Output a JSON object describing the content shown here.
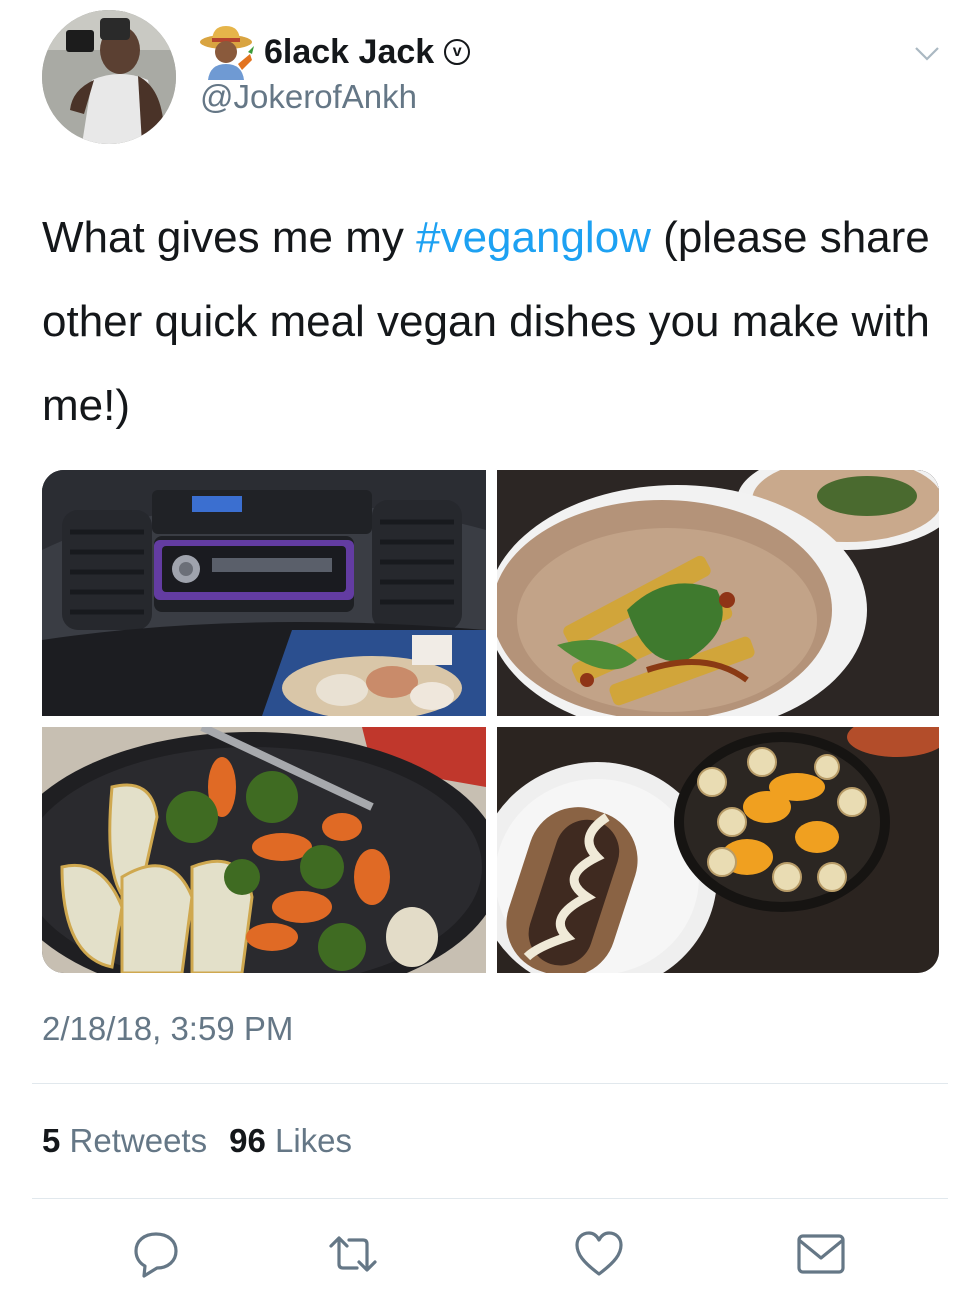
{
  "author": {
    "display_name": "6lack Jack",
    "handle": "@JokerofAnkh",
    "verified_glyph": "v",
    "avatar_icon": "profile-photo",
    "emoji_icon": "farmer-emoji"
  },
  "tweet": {
    "text_before": "What gives me my ",
    "hashtag": "#veganglow",
    "text_after": " (please share other quick meal vegan dishes you make with me!)"
  },
  "photos": [
    {
      "description_icon": "car-dashboard-food-photo"
    },
    {
      "description_icon": "tofu-wrap-photo"
    },
    {
      "description_icon": "dumplings-vegetables-photo"
    },
    {
      "description_icon": "vegan-hotdog-fruit-bowl-photo"
    }
  ],
  "timestamp": "2/18/18, 3:59 PM",
  "stats": {
    "retweets_count": "5",
    "retweets_label": "Retweets",
    "likes_count": "96",
    "likes_label": "Likes"
  },
  "actions": [
    "reply-icon",
    "retweet-icon",
    "like-icon",
    "direct-message-icon"
  ],
  "colors": {
    "text": "#14171a",
    "secondary": "#657786",
    "hashtag": "#1da1f2",
    "divider": "#e1e8ed"
  }
}
